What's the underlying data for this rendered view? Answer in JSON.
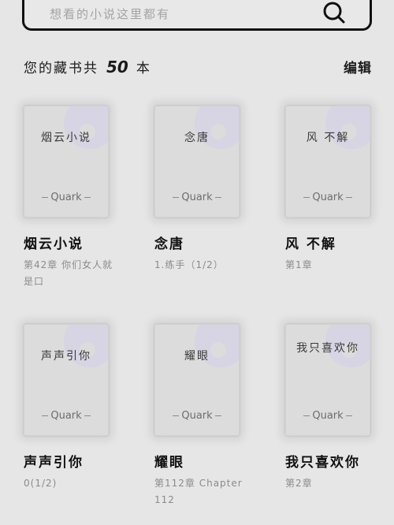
{
  "search": {
    "placeholder": "想看的小说这里都有"
  },
  "shelf": {
    "summary_prefix": "您的藏书共",
    "count": "50",
    "summary_suffix": "本",
    "edit_label": "编辑"
  },
  "books": [
    {
      "cover_title": "烟云小说",
      "brand": "Quark",
      "name": "烟云小说",
      "progress": "第42章 你们女人就是口"
    },
    {
      "cover_title": "念唐",
      "brand": "Quark",
      "name": "念唐",
      "progress": "1.练手（1/2）"
    },
    {
      "cover_title": "风 不解",
      "brand": "Quark",
      "name": "风 不解",
      "progress": "第1章"
    },
    {
      "cover_title": "声声引你",
      "brand": "Quark",
      "name": "声声引你",
      "progress": "0(1/2)"
    },
    {
      "cover_title": "耀眼",
      "brand": "Quark",
      "name": "耀眼",
      "progress": "第112章 Chapter 112"
    },
    {
      "cover_title": "我只喜欢你",
      "brand": "Quark",
      "name": "我只喜欢你",
      "progress": "第2章"
    }
  ],
  "icons": {
    "search": "search-icon"
  },
  "colors": {
    "background": "#e6e6e6",
    "text": "#1b1b1b",
    "muted": "#8b8b8b"
  }
}
